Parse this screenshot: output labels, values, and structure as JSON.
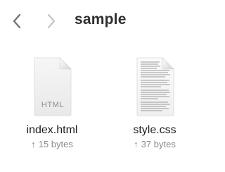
{
  "toolbar": {
    "title": "sample",
    "back_icon": "chevron-left-icon",
    "forward_icon": "chevron-right-icon"
  },
  "files": [
    {
      "name": "index.html",
      "size": "15 bytes",
      "badge": "HTML",
      "icon": "html-document-icon",
      "status_glyph": "↑"
    },
    {
      "name": "style.css",
      "size": "37 bytes",
      "icon": "text-document-icon",
      "status_glyph": "↑"
    }
  ],
  "colors": {
    "title": "#2f2f2f",
    "nav_back": "#6e6e6e",
    "nav_forward": "#c4c4c4",
    "meta_text": "#8a8a8a"
  }
}
